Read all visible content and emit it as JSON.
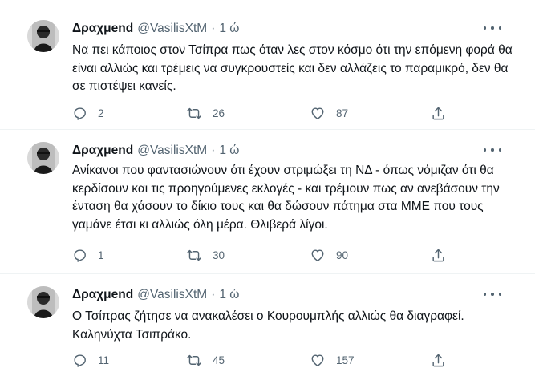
{
  "tweets": [
    {
      "name": "Δραχμend",
      "handle": "@VasilisXtM",
      "separator": "·",
      "time": "1 ώ",
      "text": "Να πει κάποιος στον Τσίπρα πως όταν λες στον κόσμο ότι την επόμενη φορά θα είναι αλλιώς και τρέμεις να συγκρουστείς και δεν αλλάζεις το παραμικρό, δεν θα σε πιστέψει κανείς.",
      "replies": "2",
      "retweets": "26",
      "likes": "87"
    },
    {
      "name": "Δραχμend",
      "handle": "@VasilisXtM",
      "separator": "·",
      "time": "1 ώ",
      "text": "Ανίκανοι που φαντασιώνουν ότι έχουν στριμώξει τη ΝΔ - όπως νόμιζαν ότι θα κερδίσουν και τις προηγούμενες εκλογές - και τρέμουν πως αν ανεβάσουν την ένταση θα χάσουν το δίκιο τους και θα δώσουν πάτημα στα ΜΜΕ που τους γαμάνε έτσι κι αλλιώς όλη μέρα. Θλιβερά λίγοι.",
      "replies": "1",
      "retweets": "30",
      "likes": "90"
    },
    {
      "name": "Δραχμend",
      "handle": "@VasilisXtM",
      "separator": "·",
      "time": "1 ώ",
      "text": "Ο Τσίπρας ζήτησε να ανακαλέσει ο Κουρουμπλής αλλιώς θα διαγραφεί. Καληνύχτα Τσιπράκο.",
      "replies": "11",
      "retweets": "45",
      "likes": "157"
    }
  ],
  "icons": {
    "reply": "reply-icon",
    "retweet": "retweet-icon",
    "like": "heart-icon",
    "share": "share-icon",
    "more": "more-icon"
  },
  "colors": {
    "text": "#0f1419",
    "muted": "#536471",
    "divider": "#eff3f4"
  }
}
